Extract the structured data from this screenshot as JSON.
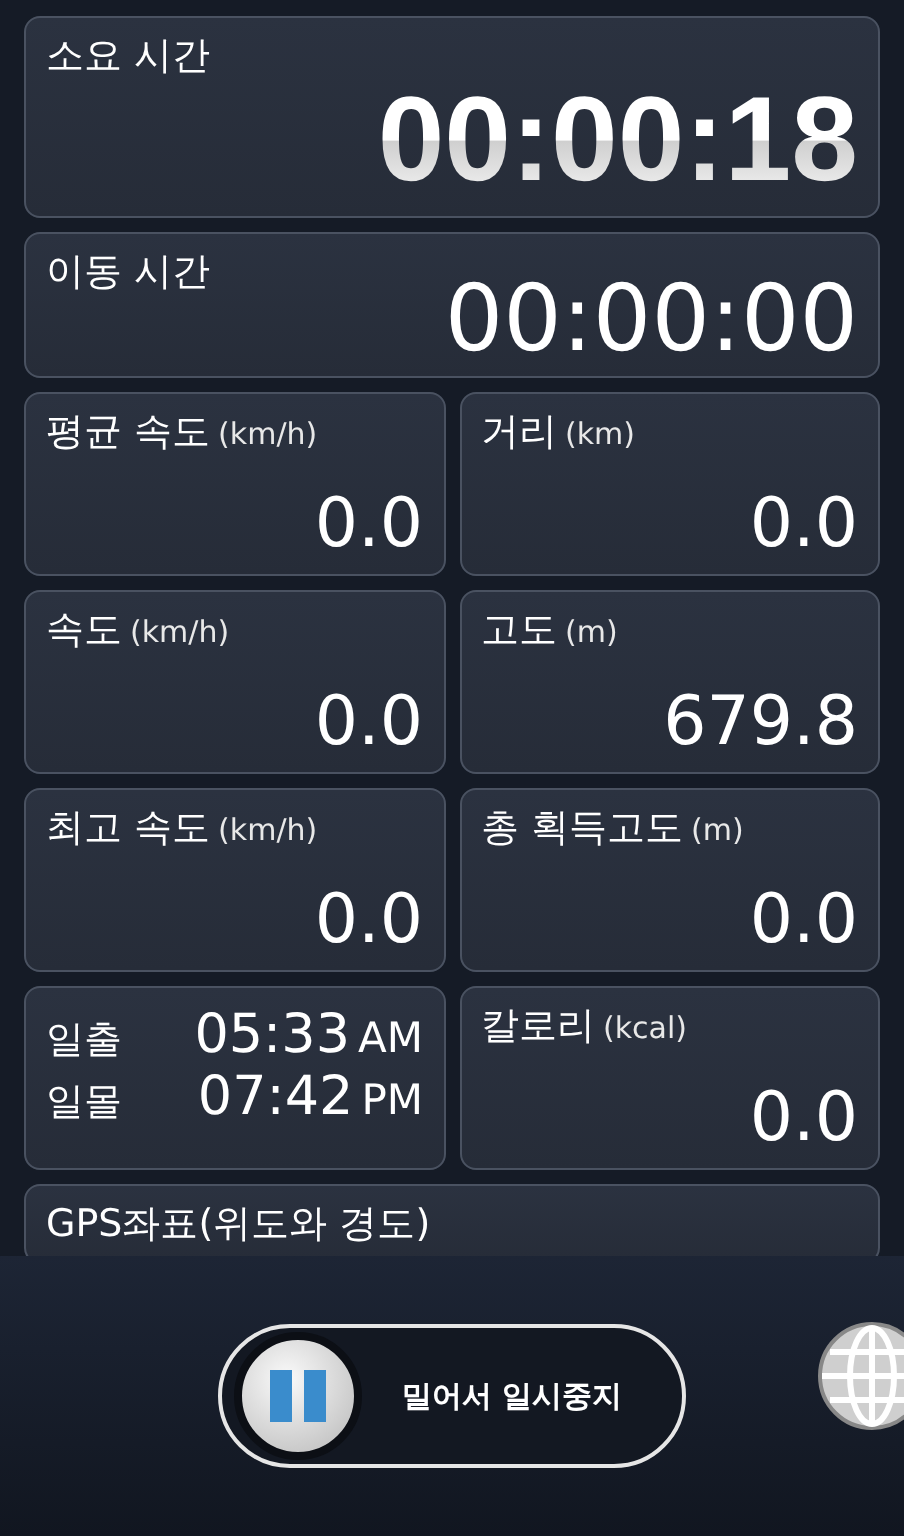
{
  "elapsed": {
    "label": "소요 시간",
    "value": "00:00:18"
  },
  "moving": {
    "label": "이동 시간",
    "value": "00:00:00"
  },
  "stats": [
    {
      "label": "평균 속도",
      "unit": "(km/h)",
      "value": "0.0"
    },
    {
      "label": "거리",
      "unit": "(km)",
      "value": "0.0"
    },
    {
      "label": "속도",
      "unit": "(km/h)",
      "value": "0.0"
    },
    {
      "label": "고도",
      "unit": "(m)",
      "value": "679.8"
    },
    {
      "label": "최고 속도",
      "unit": "(km/h)",
      "value": "0.0"
    },
    {
      "label": "총 획득고도",
      "unit": "(m)",
      "value": "0.0"
    }
  ],
  "sun": [
    {
      "label": "일출",
      "time": "05:33",
      "period": "AM"
    },
    {
      "label": "일몰",
      "time": "07:42",
      "period": "PM"
    }
  ],
  "calories": {
    "label": "칼로리",
    "unit": "(kcal)",
    "value": "0.0"
  },
  "gps": {
    "label": "GPS좌표(위도와 경도)"
  },
  "slider": {
    "label": "밀어서 일시중지"
  }
}
